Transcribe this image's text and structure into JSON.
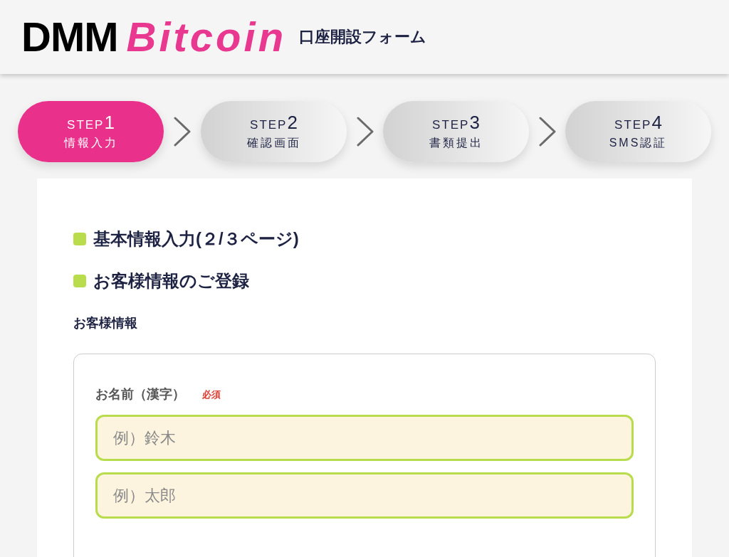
{
  "header": {
    "logo": {
      "part_1": "DMM",
      "part_2": "Bitcoin"
    },
    "title": "口座開設フォーム"
  },
  "steps": [
    {
      "prefix": "STEP",
      "number": "1",
      "name": "情報入力",
      "selected": true
    },
    {
      "prefix": "STEP",
      "number": "2",
      "name": "確認画面",
      "selected": false
    },
    {
      "prefix": "STEP",
      "number": "3",
      "name": "書類提出",
      "selected": false
    },
    {
      "prefix": "STEP",
      "number": "4",
      "name": "SMS認証",
      "selected": false
    }
  ],
  "form": {
    "headings": [
      "基本情報入力(２/３ページ)",
      "お客様情報のご登録"
    ],
    "section_title": "お客様情報",
    "fields": [
      {
        "label": "お名前（漢字）",
        "required_badge": "必須",
        "inputs": [
          {
            "placeholder": "例）鈴木"
          },
          {
            "placeholder": "例）太郎"
          }
        ]
      }
    ]
  }
}
